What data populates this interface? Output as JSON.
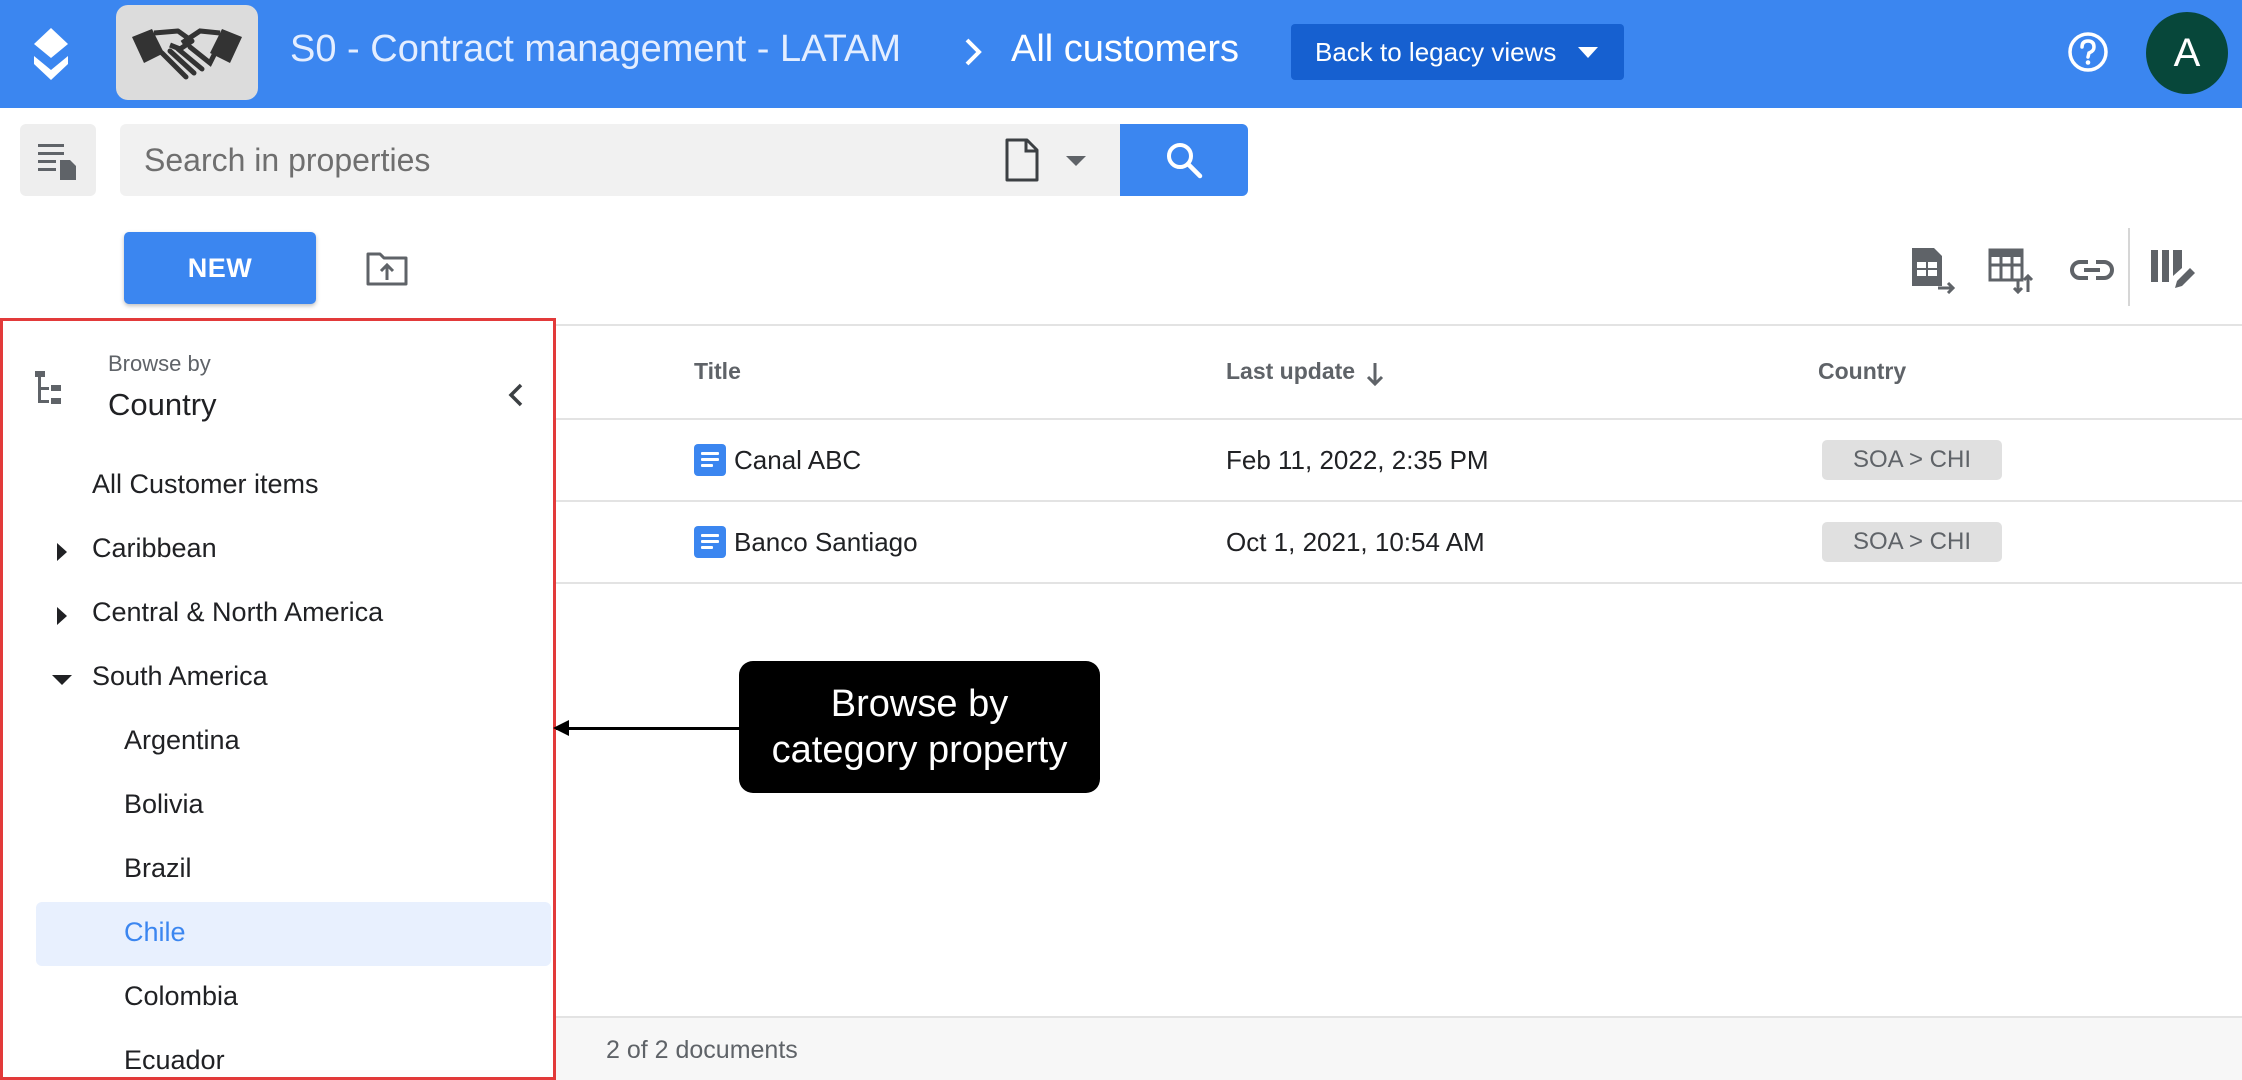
{
  "header": {
    "project_name": "S0 - Contract management - LATAM",
    "current_view": "All customers",
    "legacy_button_label": "Back to legacy views",
    "avatar_initial": "A"
  },
  "search": {
    "placeholder": "Search in properties",
    "value": ""
  },
  "actions": {
    "new_label": "NEW"
  },
  "table": {
    "columns": [
      "Title",
      "Last update",
      "Country"
    ],
    "rows": [
      {
        "title": "Canal ABC",
        "last_update": "Feb 11, 2022, 2:35 PM",
        "country": "SOA  >  CHI"
      },
      {
        "title": "Banco Santiago",
        "last_update": "Oct 1, 2021, 10:54 AM",
        "country": "SOA  >  CHI"
      }
    ],
    "footer_count": "2 of 2 documents"
  },
  "sidebar": {
    "browse_label": "Browse by",
    "browse_property": "Country",
    "items": [
      {
        "label": "All Customer items"
      },
      {
        "label": "Caribbean"
      },
      {
        "label": "Central & North America"
      },
      {
        "label": "South America"
      },
      {
        "label": "Argentina"
      },
      {
        "label": "Bolivia"
      },
      {
        "label": "Brazil"
      },
      {
        "label": "Chile"
      },
      {
        "label": "Colombia"
      },
      {
        "label": "Ecuador"
      }
    ]
  },
  "callout": {
    "line1": "Browse by",
    "line2": "category property"
  },
  "icons": {
    "app_logo": "stacked-layers-icon",
    "project_thumbnail": "handshake-icon",
    "breadcrumb_separator": "chevron-right-icon",
    "help": "help-circle-icon",
    "sidebar_toggle": "sidebar-list-icon",
    "document_type": "document-icon",
    "search": "search-icon",
    "upload": "folder-upload-icon",
    "export_sheet": "export-spreadsheet-icon",
    "import_table": "table-import-icon",
    "link": "link-icon",
    "edit_columns": "edit-columns-icon",
    "sort": "arrow-down-icon",
    "tree": "tree-structure-icon",
    "collapse": "chevron-left-icon"
  },
  "colors": {
    "primary": "#3b86f0",
    "legacy_button": "#1660d0",
    "avatar": "#07473a",
    "selected_item_bg": "#e8f0fe",
    "selected_item_text": "#3b86f0",
    "highlight_border": "#e23a3a",
    "callout_bg": "#000000"
  }
}
